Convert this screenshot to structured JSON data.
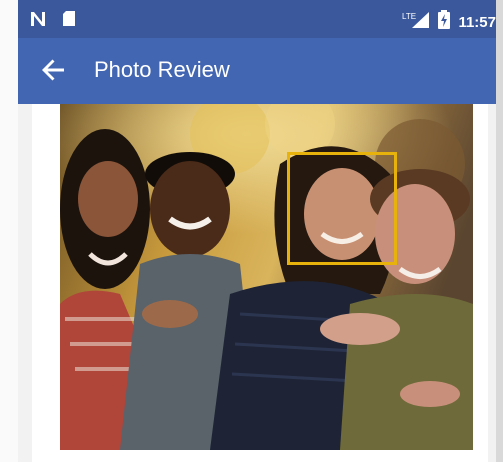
{
  "status_bar": {
    "carrier_icon": "n-logo-icon",
    "sd_icon": "sd-card-icon",
    "network_label": "LTE",
    "battery_icon": "battery-charging-icon",
    "time": "11:57"
  },
  "app_bar": {
    "title": "Photo Review",
    "back_icon": "arrow-left-icon"
  },
  "photo": {
    "description_icon": "group-photo-image",
    "face_detection": {
      "highlighted_faces": 1,
      "color": "#e8b20c"
    }
  },
  "colors": {
    "status_bar": "#3a589b",
    "app_bar": "#4266b2"
  }
}
